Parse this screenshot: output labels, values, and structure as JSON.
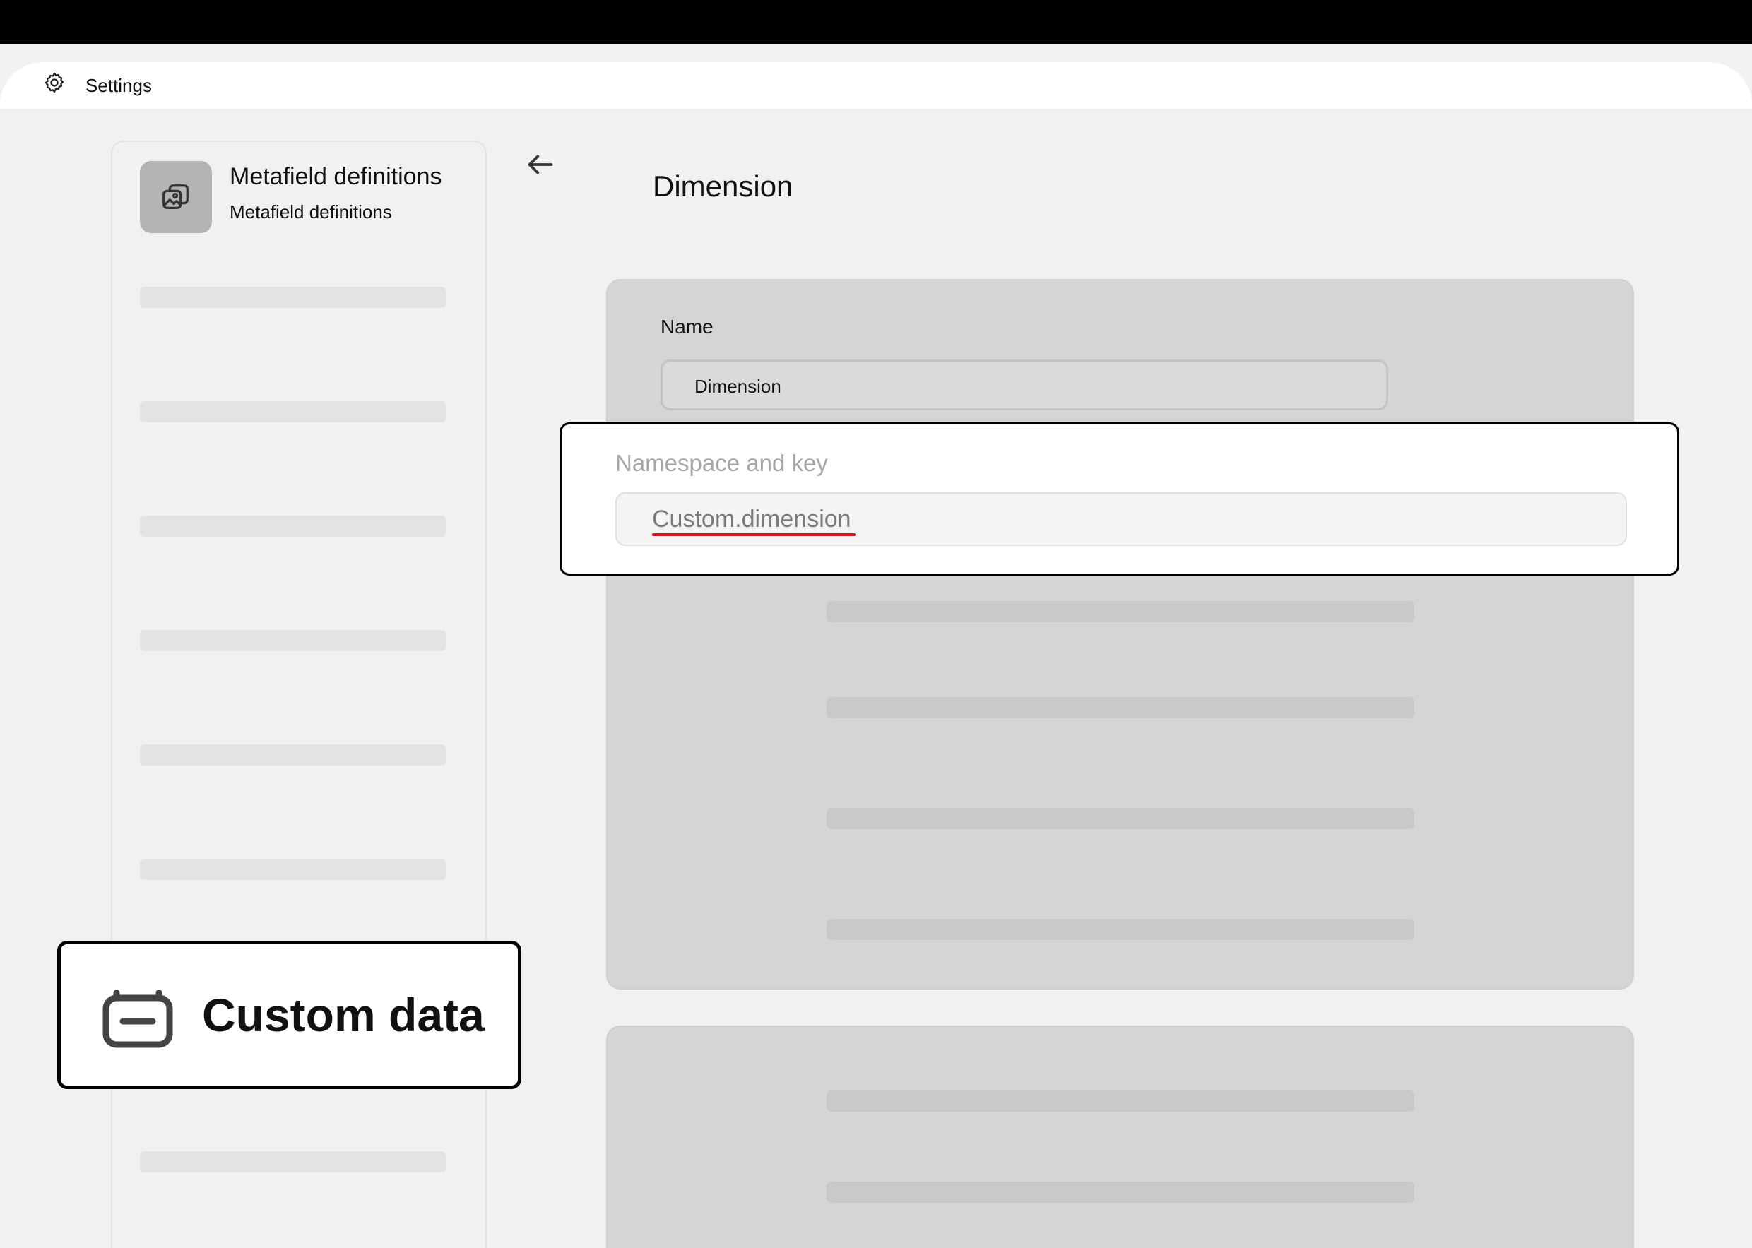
{
  "header": {
    "title": "Settings",
    "icon": "gear-icon"
  },
  "app": {
    "title": "Metafield definitions",
    "subtitle": "Metafield definitions",
    "icon": "image-stack-icon"
  },
  "page": {
    "title": "Dimension",
    "back_icon": "arrow-left-icon"
  },
  "form": {
    "name_label": "Name",
    "name_value": "Dimension",
    "namespace_label": "Namespace and key",
    "namespace_value": "Custom.dimension"
  },
  "badge": {
    "label": "Custom data",
    "icon": "custom-data-icon"
  },
  "colors": {
    "topbar": "#000000",
    "background": "#f1f1f1",
    "card": "#d5d5d5",
    "underline": "#e0131d"
  }
}
